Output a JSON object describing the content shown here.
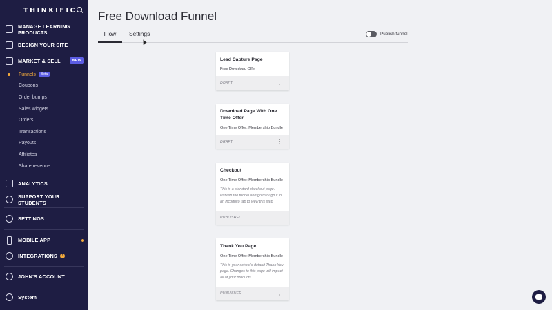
{
  "sidebar": {
    "brand": "THINKIFIC",
    "items": {
      "manage": "MANAGE LEARNING PRODUCTS",
      "design": "DESIGN YOUR SITE",
      "market": "MARKET & SELL",
      "market_badge": "NEW",
      "analytics": "ANALYTICS",
      "support": "SUPPORT YOUR STUDENTS",
      "settings": "SETTINGS",
      "mobile": "MOBILE APP",
      "integrations": "INTEGRATIONS",
      "integrations_badge": "!",
      "account": "JOHN'S ACCOUNT",
      "system": "System"
    },
    "market_sub": {
      "funnels": "Funnels",
      "funnels_badge": "Beta",
      "coupons": "Coupons",
      "order_bumps": "Order bumps",
      "sales_widgets": "Sales widgets",
      "orders": "Orders",
      "transactions": "Transactions",
      "payouts": "Payouts",
      "affiliates": "Affiliates",
      "share_revenue": "Share revenue"
    }
  },
  "page": {
    "title": "Free Download Funnel",
    "tabs": {
      "flow": "Flow",
      "settings": "Settings"
    },
    "publish_label": "Publish funnel"
  },
  "cards": [
    {
      "name": "Lead Capture Page",
      "offer": "Free Download Offer",
      "note": "",
      "status": "DRAFT"
    },
    {
      "name": "Download Page With One Time Offer",
      "offer": "One Time Offer: Membership Bundle",
      "note": "",
      "status": "DRAFT"
    },
    {
      "name": "Checkout",
      "offer": "One Time Offer: Membership Bundle",
      "note": "This is a standard checkout page. Publish the funnel and go through it in an incognito tab to view this step",
      "status": "PUBLISHED"
    },
    {
      "name": "Thank You Page",
      "offer": "One Time Offer: Membership Bundle",
      "note": "This is your school's default Thank You page. Changes to this page will impact all of your products.",
      "status": "PUBLISHED"
    }
  ],
  "colors": {
    "sidebar": "#1e1d43",
    "accent": "#f2a93b",
    "badge": "#5c5de3"
  },
  "icons": {
    "search": "search-icon",
    "kebab": "kebab-menu-icon",
    "chat": "chat-icon"
  }
}
